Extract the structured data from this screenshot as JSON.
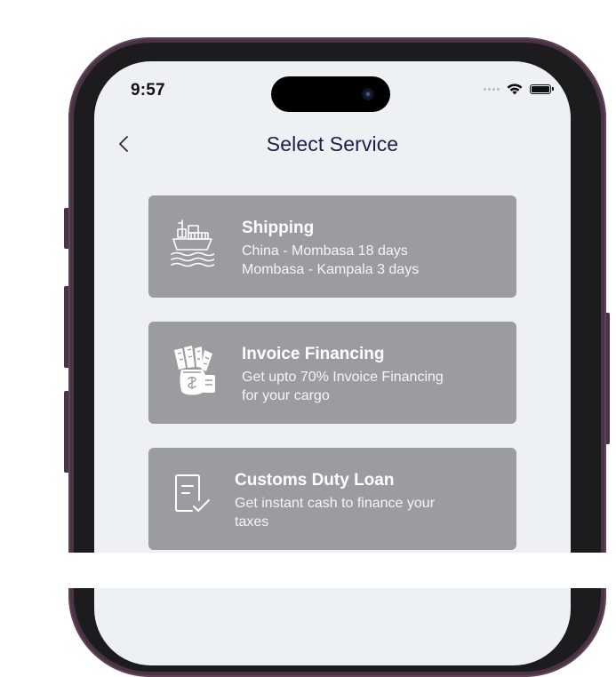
{
  "status_bar": {
    "time": "9:57"
  },
  "header": {
    "title": "Select Service"
  },
  "services": [
    {
      "title": "Shipping",
      "lines": [
        "China - Mombasa 18 days",
        "Mombasa - Kampala 3 days"
      ],
      "icon": "ship-icon"
    },
    {
      "title": "Invoice Financing",
      "lines": [
        "Get upto 70% Invoice Financing",
        "for your cargo"
      ],
      "icon": "money-bag-icon"
    },
    {
      "title": "Customs Duty Loan",
      "lines": [
        "Get instant cash to finance your",
        "taxes"
      ],
      "icon": "checklist-icon"
    }
  ],
  "colors": {
    "card_bg": "#9a9ca0",
    "title": "#1e1d4a",
    "screen_bg": "#eef1f4",
    "frame": "#4a3344"
  }
}
